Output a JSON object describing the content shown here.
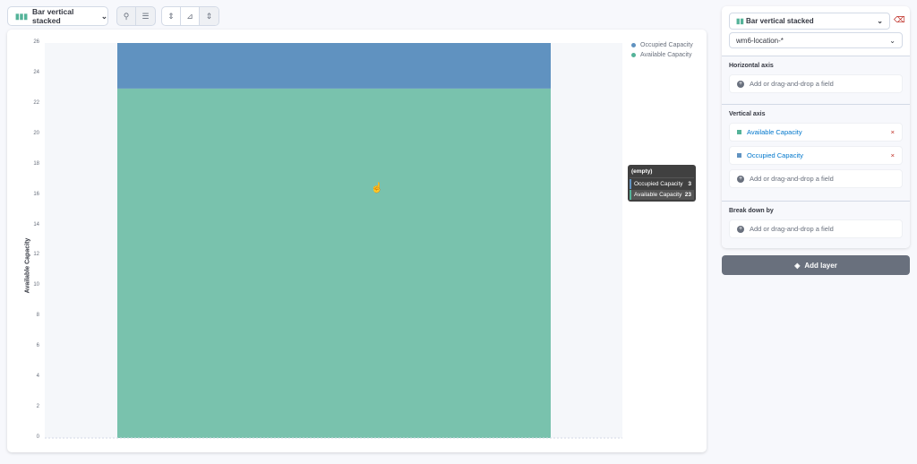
{
  "toolbar": {
    "chart_type": "Bar vertical stacked"
  },
  "chart_data": {
    "type": "bar",
    "stacked": true,
    "categories": [
      "(empty)"
    ],
    "series": [
      {
        "name": "Available Capacity",
        "values": [
          23
        ],
        "color": "#79c2ad"
      },
      {
        "name": "Occupied Capacity",
        "values": [
          3
        ],
        "color": "#6092c0"
      }
    ],
    "ylabel": "Available Capacity",
    "xlabel": "",
    "ylim": [
      0,
      26
    ],
    "yticks": [
      "0",
      "2",
      "4",
      "6",
      "8",
      "10",
      "12",
      "14",
      "16",
      "18",
      "20",
      "22",
      "24",
      "26"
    ],
    "legend": [
      "Occupied Capacity",
      "Available Capacity"
    ]
  },
  "tooltip": {
    "title": "(empty)",
    "rows": [
      {
        "label": "Occupied Capacity",
        "value": "3"
      },
      {
        "label": "Available Capacity",
        "value": "23"
      }
    ]
  },
  "side": {
    "chart_type": "Bar vertical stacked",
    "index": "wm6-location-*",
    "horizontal": "Horizontal axis",
    "vertical": "Vertical axis",
    "breakdown": "Break down by",
    "add": "Add or drag-and-drop a field",
    "fields": [
      "Available Capacity",
      "Occupied Capacity"
    ],
    "add_layer": "Add layer"
  }
}
